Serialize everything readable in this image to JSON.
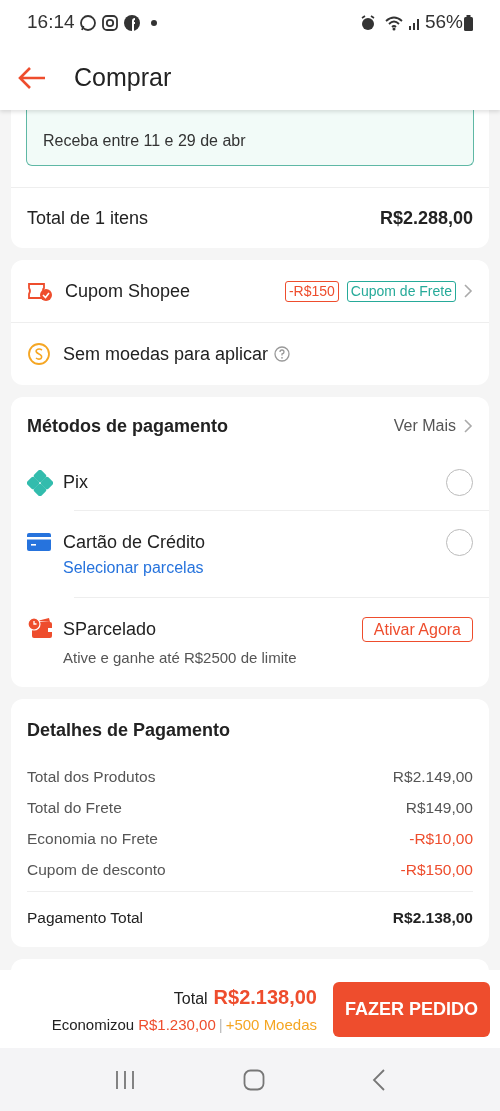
{
  "status_bar": {
    "time": "16:14",
    "battery": "56%"
  },
  "header": {
    "title": "Comprar"
  },
  "shipping": {
    "eta": "Receba entre 11 e 29 de abr"
  },
  "items_total": {
    "label": "Total de 1 itens",
    "value": "R$2.288,00"
  },
  "coupon": {
    "label": "Cupom Shopee",
    "tags": [
      {
        "text": "-R$150",
        "kind": "discount"
      },
      {
        "text": "Cupom de Frete",
        "kind": "shipping"
      }
    ]
  },
  "coins": {
    "label": "Sem moedas para aplicar"
  },
  "payment_methods": {
    "title": "Métodos de pagamento",
    "more": "Ver Mais",
    "methods": [
      {
        "kind": "pix",
        "name": "Pix",
        "selected": false
      },
      {
        "kind": "card",
        "name": "Cartão de Crédito",
        "selected": false,
        "link": "Selecionar parcelas"
      },
      {
        "kind": "installments",
        "name": "SParcelado",
        "action": "Ativar Agora",
        "subtitle": "Ative e ganhe até R$2500 de limite"
      }
    ]
  },
  "details": {
    "title": "Detalhes de Pagamento",
    "rows": [
      {
        "label": "Total dos Produtos",
        "value": "R$2.149,00",
        "kind": "normal"
      },
      {
        "label": "Total do Frete",
        "value": "R$149,00",
        "kind": "normal"
      },
      {
        "label": "Economia no Frete",
        "value": "-R$10,00",
        "kind": "discount"
      },
      {
        "label": "Cupom de desconto",
        "value": "-R$150,00",
        "kind": "discount"
      }
    ],
    "total": {
      "label": "Pagamento Total",
      "value": "R$2.138,00"
    }
  },
  "footer": {
    "total_label": "Total",
    "total": "R$2.138,00",
    "saved_label": "Economizou",
    "saved": "R$1.230,00",
    "separator": "|",
    "coins_bonus": "+500 Moedas",
    "button": "FAZER PEDIDO"
  }
}
